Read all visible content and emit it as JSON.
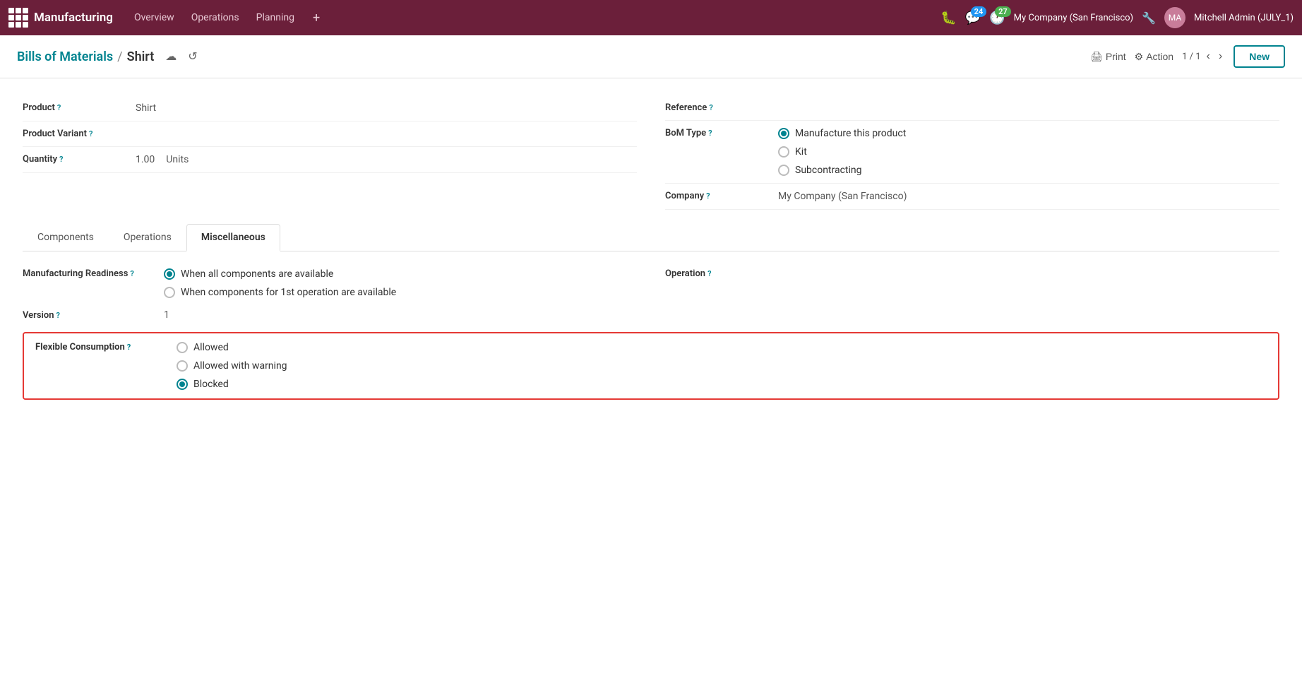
{
  "app": {
    "brand": "Manufacturing",
    "nav": [
      {
        "label": "Overview",
        "id": "overview"
      },
      {
        "label": "Operations",
        "id": "operations"
      },
      {
        "label": "Planning",
        "id": "planning"
      }
    ],
    "chat_badge": "24",
    "activity_badge": "27",
    "company": "My Company (San Francisco)",
    "user": "Mitchell Admin (JULY_1)"
  },
  "breadcrumb": {
    "parent": "Bills of Materials",
    "current": "Shirt",
    "pager": "1 / 1"
  },
  "toolbar": {
    "print_label": "Print",
    "action_label": "Action",
    "new_label": "New"
  },
  "form": {
    "product_label": "Product",
    "product_value": "Shirt",
    "product_variant_label": "Product Variant",
    "quantity_label": "Quantity",
    "quantity_value": "1.00",
    "quantity_unit": "Units",
    "reference_label": "Reference",
    "bom_type_label": "BoM Type",
    "bom_options": [
      {
        "label": "Manufacture this product",
        "checked": true
      },
      {
        "label": "Kit",
        "checked": false
      },
      {
        "label": "Subcontracting",
        "checked": false
      }
    ],
    "company_label": "Company",
    "company_value": "My Company (San Francisco)"
  },
  "tabs": [
    {
      "label": "Components",
      "id": "components",
      "active": false
    },
    {
      "label": "Operations",
      "id": "operations",
      "active": false
    },
    {
      "label": "Miscellaneous",
      "id": "miscellaneous",
      "active": true
    }
  ],
  "misc": {
    "manufacturing_readiness_label": "Manufacturing Readiness",
    "manufacturing_readiness_options": [
      {
        "label": "When all components are available",
        "checked": true
      },
      {
        "label": "When components for 1st operation are available",
        "checked": false
      }
    ],
    "operation_label": "Operation",
    "version_label": "Version",
    "version_value": "1",
    "flexible_consumption_label": "Flexible Consumption",
    "flexible_consumption_options": [
      {
        "label": "Allowed",
        "checked": false
      },
      {
        "label": "Allowed with warning",
        "checked": false
      },
      {
        "label": "Blocked",
        "checked": true
      }
    ]
  },
  "icons": {
    "grid": "⊞",
    "save_cloud": "☁",
    "undo": "↺",
    "print": "🖨",
    "gear": "⚙",
    "chevron_left": "‹",
    "chevron_right": "›",
    "bug": "🐛",
    "chat": "💬",
    "clock": "🕐",
    "wrench": "🔧"
  }
}
